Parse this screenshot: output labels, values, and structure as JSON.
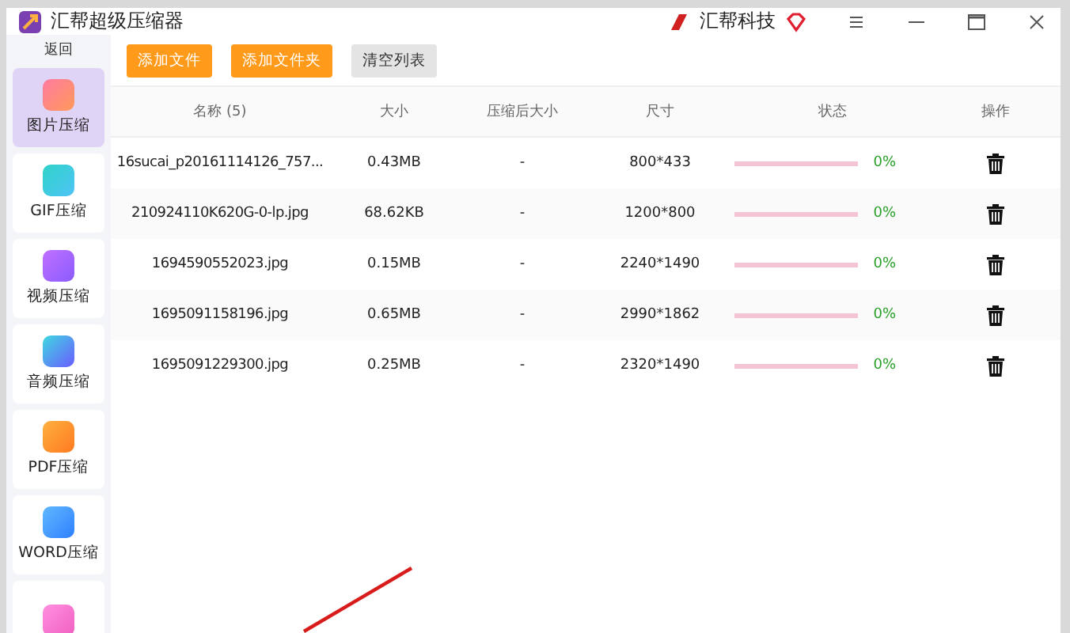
{
  "window": {
    "title": "汇帮超级压缩器",
    "brand": "汇帮科技"
  },
  "sidebar": {
    "back": "返回",
    "items": [
      {
        "label": "图片压缩",
        "kind": "image",
        "selected": true
      },
      {
        "label": "GIF压缩",
        "kind": "gif",
        "selected": false
      },
      {
        "label": "视频压缩",
        "kind": "video",
        "selected": false
      },
      {
        "label": "音频压缩",
        "kind": "audio",
        "selected": false
      },
      {
        "label": "PDF压缩",
        "kind": "pdf",
        "selected": false
      },
      {
        "label": "WORD压缩",
        "kind": "word",
        "selected": false
      },
      {
        "kind": "ppt",
        "selected": false
      }
    ]
  },
  "toolbar": [
    {
      "label": "添加文件",
      "kind": "primary"
    },
    {
      "label": "添加文件夹",
      "kind": "primary"
    },
    {
      "label": "清空列表",
      "kind": "secondary"
    }
  ],
  "table": {
    "columns": [
      "名称 (5)",
      "大小",
      "压缩后大小",
      "尺寸",
      "状态",
      "操作"
    ],
    "rows": [
      {
        "name": "16sucai_p20161114126_757...",
        "size": "0.43MB",
        "compressed": "-",
        "dimensions": "800*433",
        "level": 0,
        "percent": "0%"
      },
      {
        "name": "210924110K620G-0-lp.jpg",
        "size": "68.62KB",
        "compressed": "-",
        "dimensions": "1200*800",
        "level": 0,
        "percent": "0%"
      },
      {
        "name": "1694590552023.jpg",
        "size": "0.15MB",
        "compressed": "-",
        "dimensions": "2240*1490",
        "level": 0,
        "percent": "0%"
      },
      {
        "name": "1695091158196.jpg",
        "size": "0.65MB",
        "compressed": "-",
        "dimensions": "2990*1862",
        "level": 0,
        "percent": "0%"
      },
      {
        "name": "1695091229300.jpg",
        "size": "0.25MB",
        "compressed": "-",
        "dimensions": "2320*1490",
        "level": 0,
        "percent": "0%"
      }
    ]
  }
}
